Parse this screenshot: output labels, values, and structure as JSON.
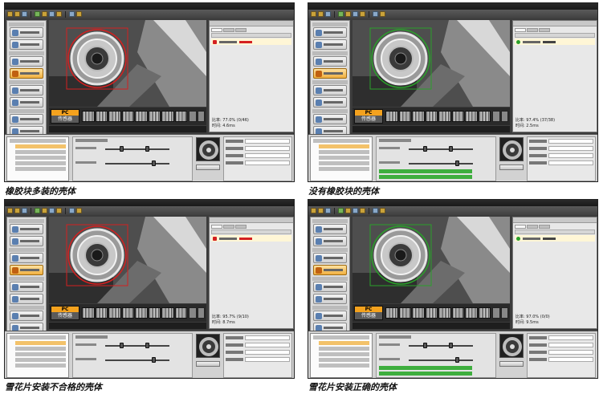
{
  "panels": [
    {
      "caption": "橡胶块多装的壳体",
      "pc_label": "PC",
      "sensor_label": "传感器",
      "status": "fail",
      "stats": [
        "比率: 77.0% (0/46)",
        "时间: 4.6ms"
      ]
    },
    {
      "caption": "没有橡胶块的壳体",
      "pc_label": "PC",
      "sensor_label": "传感器",
      "status": "pass",
      "stats": [
        "比率: 97.4% (37/38)",
        "时间: 2.5ms"
      ]
    },
    {
      "caption": "雪花片安装不合格的壳体",
      "pc_label": "PC",
      "sensor_label": "传感器",
      "status": "fail",
      "stats": [
        "比率: 95.7% (9/10)",
        "时间: 8.7ms"
      ]
    },
    {
      "caption": "雪花片安装正确的壳体",
      "pc_label": "PC",
      "sensor_label": "传感器",
      "status": "pass",
      "stats": [
        "比率: 97.0% (0/0)",
        "时间: 9.5ms"
      ]
    }
  ],
  "colors": {
    "fail": "#d42020",
    "pass": "#2aa02a",
    "sensor_accent": "#f4a21e"
  }
}
